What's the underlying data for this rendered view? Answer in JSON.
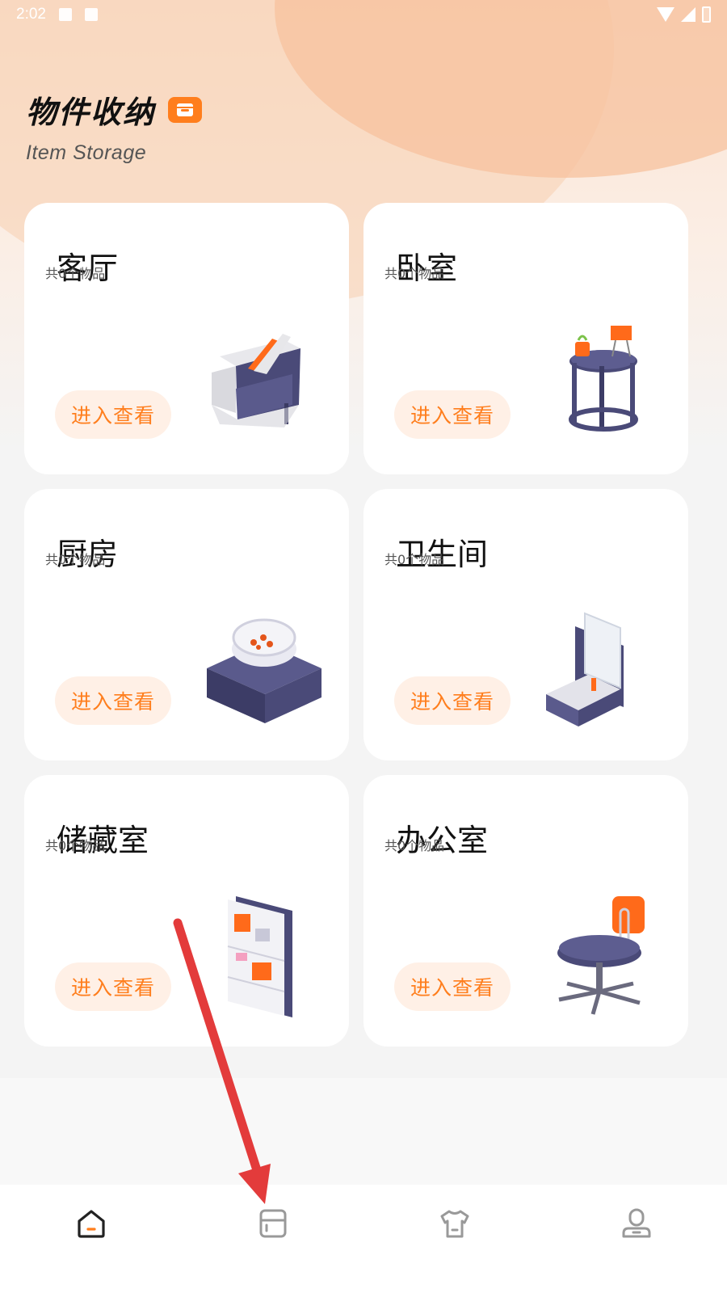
{
  "status_bar": {
    "time": "2:02"
  },
  "header": {
    "title": "物件收纳",
    "subtitle": "Item Storage"
  },
  "rooms": [
    {
      "name": "客厅",
      "count": "共0个物品",
      "button": "进入查看",
      "illustration": "sofa"
    },
    {
      "name": "卧室",
      "count": "共0个物品",
      "button": "进入查看",
      "illustration": "side-table"
    },
    {
      "name": "厨房",
      "count": "共0个物品",
      "button": "进入查看",
      "illustration": "stove-pot"
    },
    {
      "name": "卫生间",
      "count": "共0个物品",
      "button": "进入查看",
      "illustration": "sink-mirror"
    },
    {
      "name": "储藏室",
      "count": "共0个物品",
      "button": "进入查看",
      "illustration": "shelf"
    },
    {
      "name": "办公室",
      "count": "共0个物品",
      "button": "进入查看",
      "illustration": "office-chair"
    }
  ],
  "tabs": [
    {
      "icon": "home-icon",
      "active": true
    },
    {
      "icon": "storage-icon",
      "active": false
    },
    {
      "icon": "clothing-icon",
      "active": false
    },
    {
      "icon": "profile-icon",
      "active": false
    }
  ],
  "colors": {
    "accent": "#ff7e1d",
    "button_bg": "#fff0e6",
    "navy": "#4a4a78"
  }
}
